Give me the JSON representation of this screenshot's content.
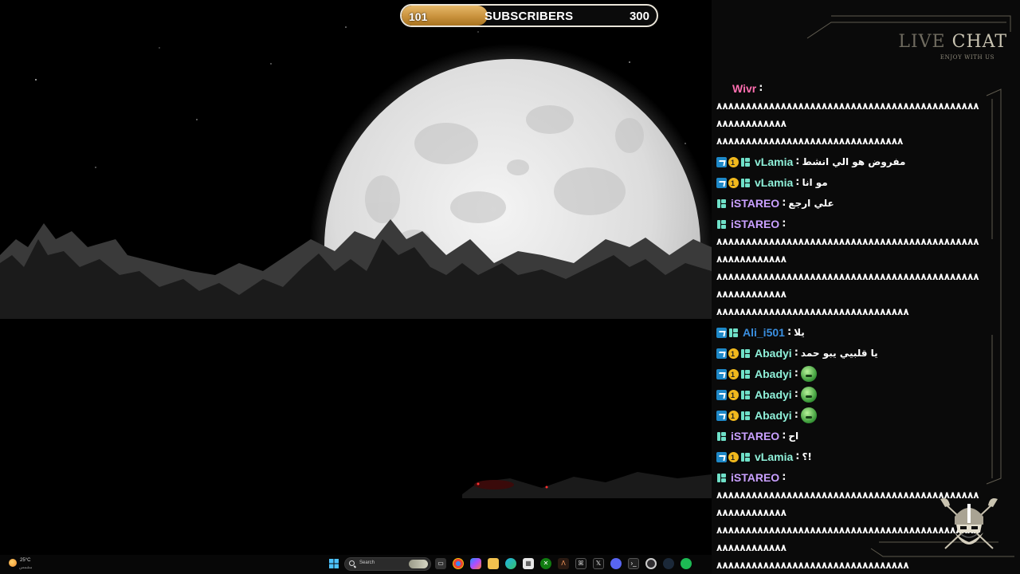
{
  "subscriber_goal": {
    "current": "101",
    "label": "SUBSCRIBERS",
    "goal": "300",
    "progress_fraction": 0.3367,
    "accent_color": "#d39a43"
  },
  "taskbar": {
    "weather": {
      "temperature": "25°C",
      "condition": "مشمس"
    },
    "search_placeholder": "Search",
    "pinned_icons": [
      "windows-start-icon",
      "task-view-icon",
      "chrome-icon",
      "copilot-icon",
      "file-explorer-icon",
      "edge-icon",
      "microsoft-store-icon",
      "xbox-icon",
      "affinity-icon",
      "capcut-icon",
      "x-icon",
      "discord-icon",
      "terminal-icon",
      "obs-icon",
      "steam-icon",
      "spotify-icon"
    ]
  },
  "chat": {
    "title_part1": "LIVE",
    "title_part2": "CHAT",
    "subtitle": "ENJOY WITH US",
    "messages": [
      {
        "user": "Wivr",
        "color": "#ff6fb0",
        "badges": [],
        "text": "",
        "spam_lines": [
          "٨٨٨٨٨٨٨٨٨٨٨٨٨٨٨٨٨٨٨٨٨٨٨٨٨٨٨٨٨٨٨٨٨٨٨٨٨٨٨٨٨٨٨٨٨٨٨٨٨٨٨٨٨٨٨٨٨",
          "٨٨٨٨٨٨٨٨٨٨٨٨٨٨٨٨٨٨٨٨٨٨٨٨٨٨٨٨٨٨٨٨"
        ],
        "emote": false
      },
      {
        "user": "vLamia",
        "color": "#8ff0d9",
        "badges": [
          "prime",
          "sub1",
          "chip"
        ],
        "text": "مفروض هو الي انشط",
        "spam_lines": [],
        "emote": false
      },
      {
        "user": "vLamia",
        "color": "#8ff0d9",
        "badges": [
          "prime",
          "sub1",
          "chip"
        ],
        "text": "مو انا",
        "spam_lines": [],
        "emote": false
      },
      {
        "user": "iSTAREO",
        "color": "#c9a0ff",
        "badges": [
          "chip"
        ],
        "text": "علي ارجع",
        "spam_lines": [],
        "emote": false
      },
      {
        "user": "iSTAREO",
        "color": "#c9a0ff",
        "badges": [
          "chip"
        ],
        "text": "",
        "spam_lines": [
          "٨٨٨٨٨٨٨٨٨٨٨٨٨٨٨٨٨٨٨٨٨٨٨٨٨٨٨٨٨٨٨٨٨٨٨٨٨٨٨٨٨٨٨٨٨٨٨٨٨٨٨٨٨٨٨٨٨",
          "٨٨٨٨٨٨٨٨٨٨٨٨٨٨٨٨٨٨٨٨٨٨٨٨٨٨٨٨٨٨٨٨٨٨٨٨٨٨٨٨٨٨٨٨٨٨٨٨٨٨٨٨٨٨٨٨٨",
          "٨٨٨٨٨٨٨٨٨٨٨٨٨٨٨٨٨٨٨٨٨٨٨٨٨٨٨٨٨٨٨٨٨"
        ],
        "emote": false
      },
      {
        "user": "Ali_i501",
        "color": "#3a8fe0",
        "badges": [
          "prime",
          "chip"
        ],
        "text": "يلا",
        "spam_lines": [],
        "emote": false
      },
      {
        "user": "Abadyi",
        "color": "#8ff0d9",
        "badges": [
          "prime",
          "sub1",
          "chip"
        ],
        "text": "يا قلبيي يبو حمد",
        "spam_lines": [],
        "emote": false
      },
      {
        "user": "Abadyi",
        "color": "#8ff0d9",
        "badges": [
          "prime",
          "sub1",
          "chip"
        ],
        "text": "",
        "spam_lines": [],
        "emote": true
      },
      {
        "user": "Abadyi",
        "color": "#8ff0d9",
        "badges": [
          "prime",
          "sub1",
          "chip"
        ],
        "text": "",
        "spam_lines": [],
        "emote": true
      },
      {
        "user": "Abadyi",
        "color": "#8ff0d9",
        "badges": [
          "prime",
          "sub1",
          "chip"
        ],
        "text": "",
        "spam_lines": [],
        "emote": true
      },
      {
        "user": "iSTAREO",
        "color": "#c9a0ff",
        "badges": [
          "chip"
        ],
        "text": "اح",
        "spam_lines": [],
        "emote": false
      },
      {
        "user": "vLamia",
        "color": "#8ff0d9",
        "badges": [
          "prime",
          "sub1",
          "chip"
        ],
        "text": "!؟",
        "spam_lines": [],
        "emote": false
      },
      {
        "user": "iSTAREO",
        "color": "#c9a0ff",
        "badges": [
          "chip"
        ],
        "text": "",
        "spam_lines": [
          "٨٨٨٨٨٨٨٨٨٨٨٨٨٨٨٨٨٨٨٨٨٨٨٨٨٨٨٨٨٨٨٨٨٨٨٨٨٨٨٨٨٨٨٨٨٨٨٨٨٨٨٨٨٨٨٨٨",
          "٨٨٨٨٨٨٨٨٨٨٨٨٨٨٨٨٨٨٨٨٨٨٨٨٨٨٨٨٨٨٨٨٨٨٨٨٨٨٨٨٨٨٨٨٨٨٨٨٨٨٨٨٨٨٨٨٨",
          "٨٨٨٨٨٨٨٨٨٨٨٨٨٨٨٨٨٨٨٨٨٨٨٨٨٨٨٨٨٨٨٨٨"
        ],
        "emote": false
      }
    ]
  }
}
